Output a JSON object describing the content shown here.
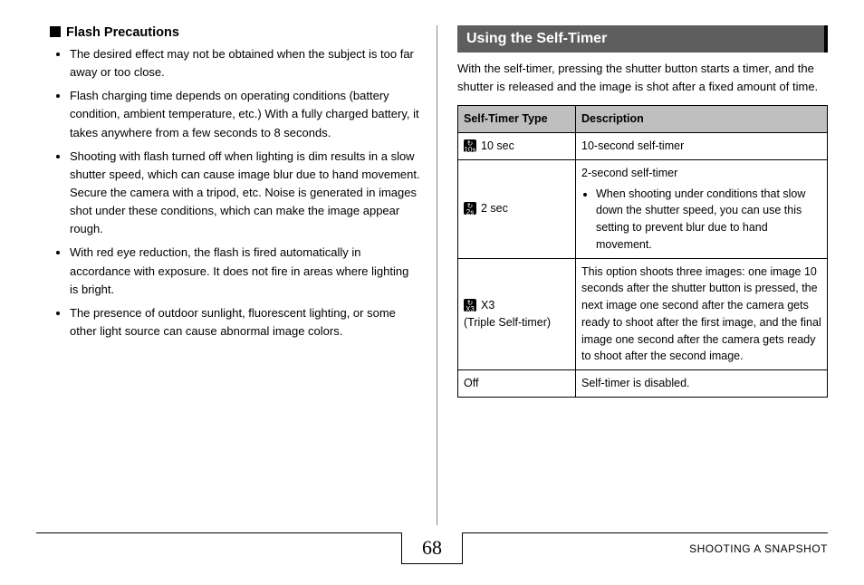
{
  "left": {
    "heading": "Flash Precautions",
    "bullets": [
      "The desired effect may not be obtained when the subject is too far away or too close.",
      "Flash charging time depends on operating conditions (battery condition, ambient temperature, etc.) With a fully charged battery, it takes anywhere from a few seconds to 8 seconds.",
      "Shooting with flash turned off when lighting is dim results in a slow shutter speed, which can cause image blur due to hand movement. Secure the camera with a tripod, etc. Noise is generated in images shot under these conditions, which can make the image appear rough.",
      "With red eye reduction, the flash is fired automatically in accordance with exposure. It does not fire in areas where lighting is bright.",
      "The presence of outdoor sunlight, fluorescent lighting, or some other light source can cause abnormal image colors."
    ]
  },
  "right": {
    "title": "Using the Self-Timer",
    "intro": "With the self-timer, pressing the shutter button starts a timer, and the shutter is released and the image is shot after a fixed amount of time.",
    "table": {
      "head_type": "Self-Timer Type",
      "head_desc": "Description",
      "rows": [
        {
          "icon": "10s",
          "type_label": "10 sec",
          "desc": "10-second self-timer"
        },
        {
          "icon": "2s",
          "type_label": "2 sec",
          "desc_lead": "2-second self-timer",
          "desc_bullet": "When shooting under conditions that slow down the shutter speed, you can use this setting to prevent blur due to hand movement."
        },
        {
          "icon": "X3",
          "type_label": "X3",
          "type_sub": "(Triple Self-timer)",
          "desc": "This option shoots three images: one image 10 seconds after the shutter button is pressed, the next image one second after the camera gets ready to shoot after the first image, and the final image one second after the camera gets ready to shoot after the second image."
        },
        {
          "icon": "",
          "type_label": "Off",
          "desc": "Self-timer is disabled."
        }
      ]
    }
  },
  "footer": {
    "section": "SHOOTING A SNAPSHOT",
    "page": "68"
  }
}
